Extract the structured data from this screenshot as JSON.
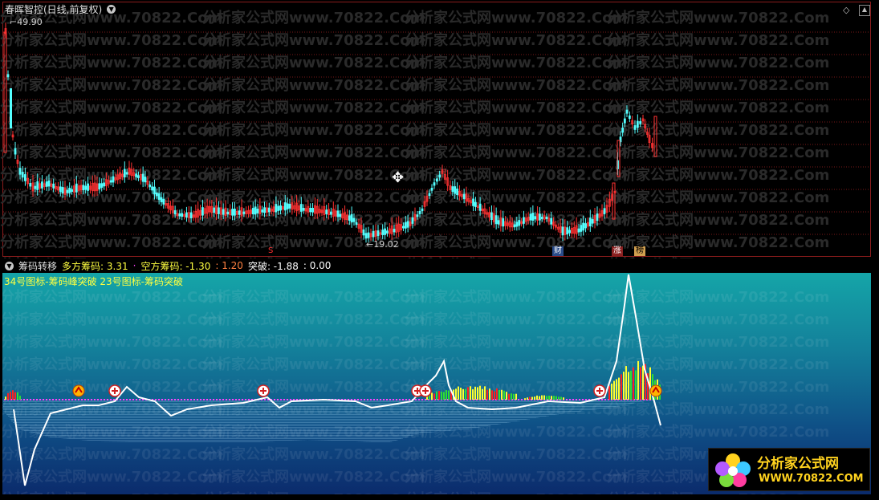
{
  "header": {
    "title": "春晖智控(日线,前复权)",
    "high_price": "49.90",
    "low_price": "19.02"
  },
  "indicator": {
    "name": "筹码转移",
    "long_label": "多方筹码",
    "long_value": ": 3.31",
    "short_label": "空方筹码",
    "short_value": ": -1.30",
    "extra_value": ": 1.20",
    "break_label": "突破",
    "break_value": ": -1.88",
    "last_value": ": 0.00",
    "legend_line": "34号图标-筹码峰突破 23号图标-筹码突破"
  },
  "markers": {
    "s_marker": "S",
    "cai": "财",
    "zhang": "涨",
    "bang": "榜"
  },
  "watermark": {
    "text": "分析家公式网www.70822.Com"
  },
  "logo": {
    "cn": "分析家公式网",
    "url": "WWW.70822.COM"
  },
  "colors": {
    "up": "#ff3232",
    "down": "#54ffff",
    "grid": "#8a1c1c",
    "white_line": "#ffffff"
  }
}
